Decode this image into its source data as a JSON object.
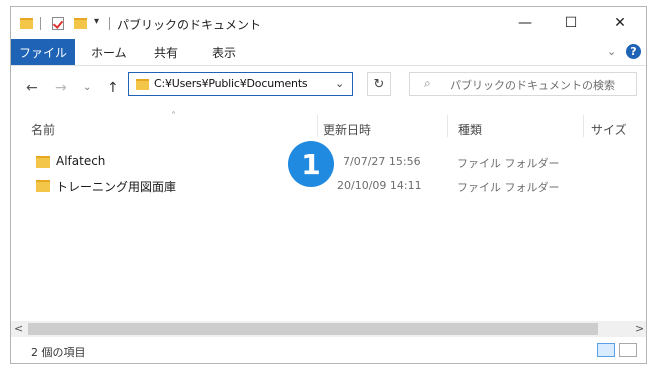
{
  "titlebar": {
    "title": "パブリックのドキュメント",
    "minimize": "—",
    "maximize": "☐",
    "close": "✕"
  },
  "ribbon": {
    "tabs": [
      "ファイル",
      "ホーム",
      "共有",
      "表示"
    ]
  },
  "nav": {
    "address": "C:¥Users¥Public¥Documents",
    "search_placeholder": "パブリックのドキュメントの検索"
  },
  "columns": [
    "名前",
    "更新日時",
    "種類",
    "サイズ"
  ],
  "files": [
    {
      "name": "Alfatech",
      "date": "7/07/27 15:56",
      "type": "ファイル フォルダー"
    },
    {
      "name": "トレーニング用図面庫",
      "date": "20/10/09 14:11",
      "type": "ファイル フォルダー"
    }
  ],
  "status": {
    "items": "2 個の項目"
  },
  "annotation": {
    "badge": "1"
  },
  "colors": {
    "accent": "#1e63b6",
    "badge": "#2089e0",
    "folder": "#f3c64a"
  }
}
